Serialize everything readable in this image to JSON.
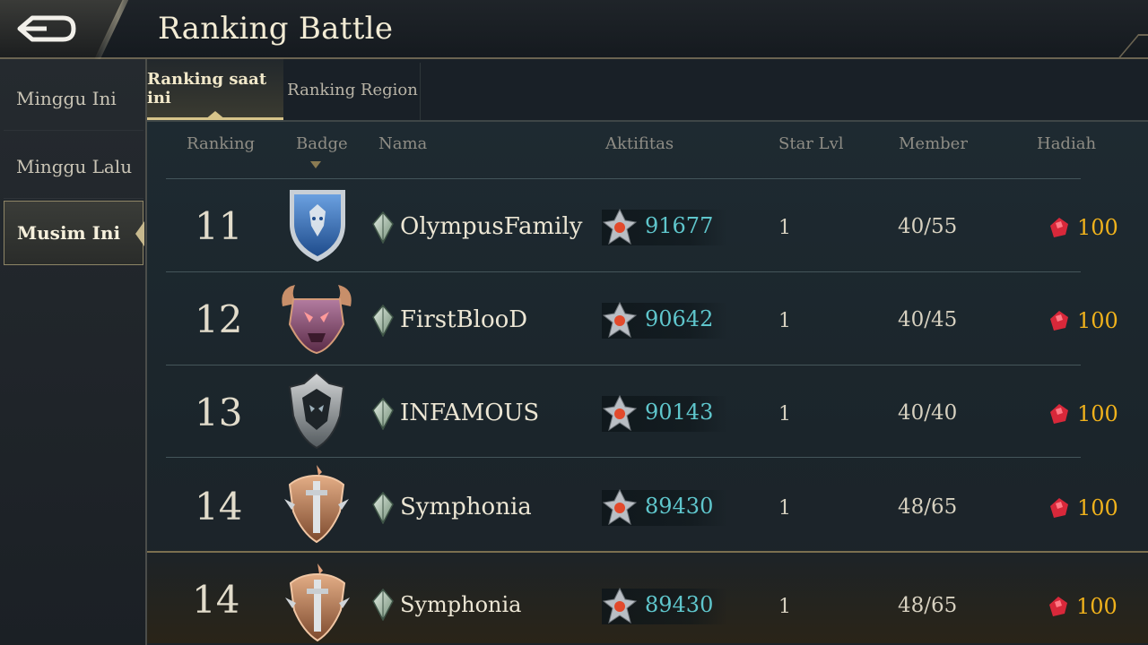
{
  "header": {
    "title": "Ranking Battle"
  },
  "sidebar": {
    "items": [
      {
        "label": "Minggu Ini"
      },
      {
        "label": "Minggu Lalu"
      },
      {
        "label": "Musim Ini"
      }
    ]
  },
  "tabs": [
    {
      "label": "Ranking saat ini"
    },
    {
      "label": "Ranking Region"
    }
  ],
  "columns": [
    "Ranking",
    "Badge",
    "Nama",
    "Aktifitas",
    "Star Lvl",
    "Member",
    "Hadiah"
  ],
  "rows": [
    {
      "rank": "11",
      "badge_icon": "blue-wolf-shield-badge-icon",
      "name": "OlympusFamily",
      "activity": "91677",
      "star_lvl": "1",
      "member": "40/55",
      "reward": "100"
    },
    {
      "rank": "12",
      "badge_icon": "purple-skull-horns-badge-icon",
      "name": "FirstBlooD",
      "activity": "90642",
      "star_lvl": "1",
      "member": "40/45",
      "reward": "100"
    },
    {
      "rank": "13",
      "badge_icon": "silver-dark-skull-badge-icon",
      "name": "INFAMOUS",
      "activity": "90143",
      "star_lvl": "1",
      "member": "40/40",
      "reward": "100"
    },
    {
      "rank": "14",
      "badge_icon": "bronze-sword-shield-badge-icon",
      "name": "Symphonia",
      "activity": "89430",
      "star_lvl": "1",
      "member": "48/65",
      "reward": "100"
    }
  ],
  "my_row": {
    "rank": "14",
    "badge_icon": "bronze-sword-shield-badge-icon",
    "name": "Symphonia",
    "activity": "89430",
    "star_lvl": "1",
    "member": "48/65",
    "reward": "100"
  },
  "colors": {
    "accent_gold": "#d7c48a",
    "activity_cyan": "#5fc6cc",
    "reward_gold": "#f0b21c",
    "gem_red": "#d8283a"
  }
}
